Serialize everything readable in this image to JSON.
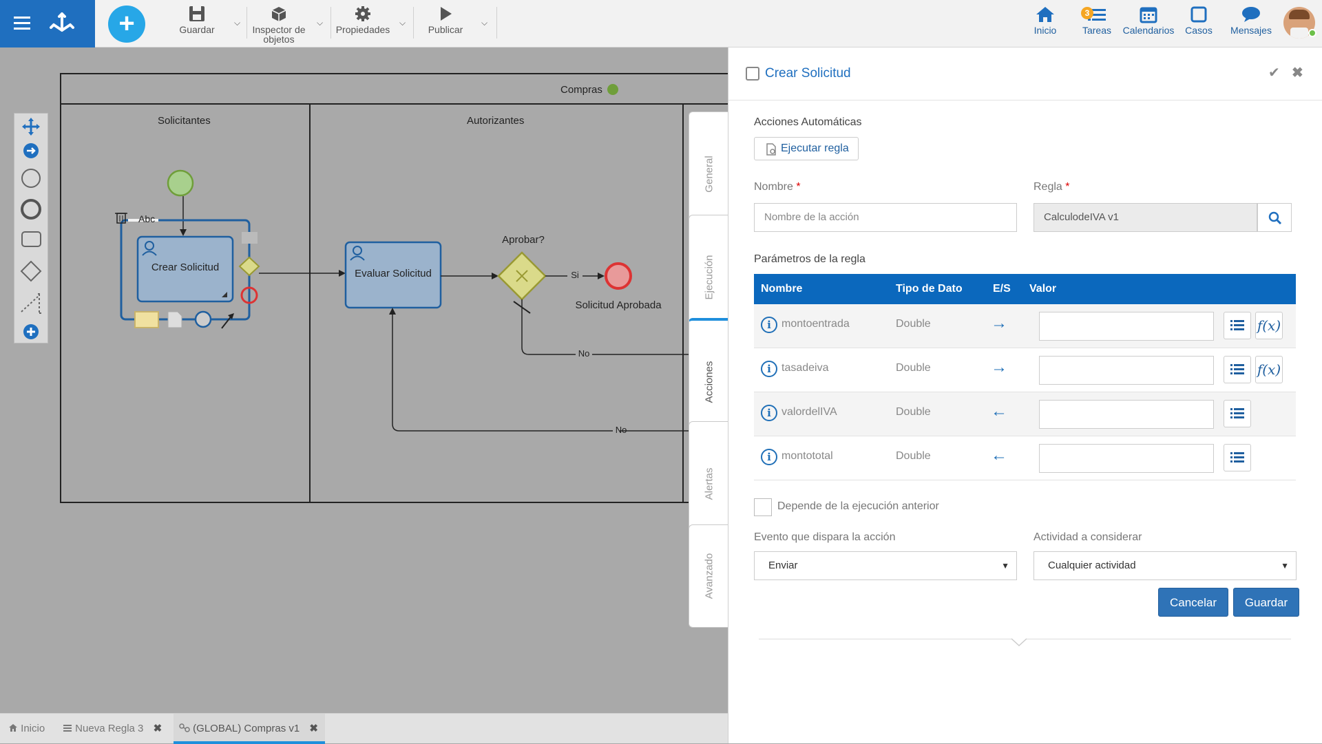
{
  "toolbar": {
    "guardar": "Guardar",
    "inspector_line1": "Inspector de",
    "inspector_line2": "objetos",
    "propiedades": "Propiedades",
    "publicar": "Publicar"
  },
  "nav": {
    "inicio": "Inicio",
    "tareas": "Tareas",
    "tareas_badge": "3",
    "calendarios": "Calendarios",
    "casos": "Casos",
    "mensajes": "Mensajes"
  },
  "diagram": {
    "pool_title": "Compras",
    "lane1": "Solicitantes",
    "lane2": "Autorizantes",
    "task1": "Crear Solicitud",
    "task2": "Evaluar Solicitud",
    "gateway_label": "Aprobar?",
    "end_label": "Solicitud Aprobada",
    "flow_si": "Si",
    "flow_no1": "No",
    "flow_no2": "No",
    "abc": "Abc"
  },
  "vtabs": {
    "general": "General",
    "ejecucion": "Ejecución",
    "acciones": "Acciones",
    "alertas": "Alertas",
    "avanzado": "Avanzado"
  },
  "panel": {
    "title": "Crear Solicitud",
    "section": "Acciones Automáticas",
    "ejecutar_regla": "Ejecutar regla",
    "nombre_label": "Nombre",
    "nombre_placeholder": "Nombre de la acción",
    "regla_label": "Regla",
    "regla_value": "CalculodeIVA v1",
    "params_label": "Parámetros de la regla",
    "columns": [
      "Nombre",
      "Tipo de Dato",
      "E/S",
      "Valor"
    ],
    "rows": [
      {
        "name": "montoentrada",
        "type": "Double",
        "io": "→"
      },
      {
        "name": "tasadeiva",
        "type": "Double",
        "io": "→"
      },
      {
        "name": "valordelIVA",
        "type": "Double",
        "io": "←"
      },
      {
        "name": "montototal",
        "type": "Double",
        "io": "←"
      }
    ],
    "fx_label": "f(x)",
    "depende": "Depende de la ejecución anterior",
    "evento_label": "Evento que dispara la acción",
    "evento_value": "Enviar",
    "actividad_label": "Actividad a considerar",
    "actividad_value": "Cualquier actividad",
    "cancelar": "Cancelar",
    "guardar": "Guardar"
  },
  "bottom_tabs": {
    "inicio": "Inicio",
    "regla": "Nueva Regla 3",
    "compras": "(GLOBAL) Compras v1"
  },
  "colors": {
    "accent": "#0b68bd",
    "brand": "#1f6fbf",
    "plus": "#27a7e7",
    "task_fill": "#9bb3cc",
    "gateway_fill": "#dada8a",
    "start_event": "#a8d08d",
    "end_event": "#e84b4b"
  }
}
